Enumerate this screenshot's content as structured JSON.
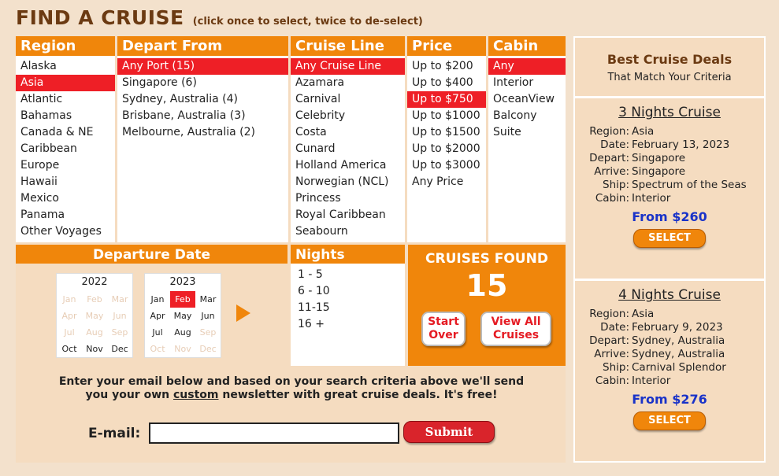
{
  "header": {
    "title": "FIND A CRUISE",
    "hint": "(click once to select, twice to de-select)"
  },
  "columns": {
    "region": {
      "label": "Region",
      "options": [
        "Alaska",
        "Asia",
        "Atlantic",
        "Bahamas",
        "Canada & NE",
        "Caribbean",
        "Europe",
        "Hawaii",
        "Mexico",
        "Panama",
        "Other Voyages"
      ],
      "selected": "Asia"
    },
    "depart": {
      "label": "Depart From",
      "options": [
        "Any Port (15)",
        "Singapore (6)",
        "Sydney, Australia (4)",
        "Brisbane, Australia (3)",
        "Melbourne, Australia (2)"
      ],
      "selected": "Any Port (15)"
    },
    "line": {
      "label": "Cruise Line",
      "options": [
        "Any Cruise Line",
        "Azamara",
        "Carnival",
        "Celebrity",
        "Costa",
        "Cunard",
        "Holland America",
        "Norwegian (NCL)",
        "Princess",
        "Royal Caribbean",
        "Seabourn"
      ],
      "selected": "Any Cruise Line"
    },
    "price": {
      "label": "Price",
      "options": [
        "Up to $200",
        "Up to $400",
        "Up to $750",
        "Up to $1000",
        "Up to $1500",
        "Up to $2000",
        "Up to $3000",
        "Any Price"
      ],
      "selected": "Up to $750"
    },
    "cabin": {
      "label": "Cabin",
      "options": [
        "Any",
        "Interior",
        "OceanView",
        "Balcony",
        "Suite"
      ],
      "selected": "Any"
    }
  },
  "departure": {
    "label": "Departure Date",
    "calendars": [
      {
        "year": "2022",
        "months": [
          {
            "m": "Jan",
            "state": "disabled"
          },
          {
            "m": "Feb",
            "state": "disabled"
          },
          {
            "m": "Mar",
            "state": "disabled"
          },
          {
            "m": "Apr",
            "state": "disabled"
          },
          {
            "m": "May",
            "state": "disabled"
          },
          {
            "m": "Jun",
            "state": "disabled"
          },
          {
            "m": "Jul",
            "state": "disabled"
          },
          {
            "m": "Aug",
            "state": "disabled"
          },
          {
            "m": "Sep",
            "state": "disabled"
          },
          {
            "m": "Oct",
            "state": "enabled"
          },
          {
            "m": "Nov",
            "state": "enabled"
          },
          {
            "m": "Dec",
            "state": "enabled"
          }
        ]
      },
      {
        "year": "2023",
        "months": [
          {
            "m": "Jan",
            "state": "enabled"
          },
          {
            "m": "Feb",
            "state": "selected"
          },
          {
            "m": "Mar",
            "state": "enabled"
          },
          {
            "m": "Apr",
            "state": "enabled"
          },
          {
            "m": "May",
            "state": "enabled"
          },
          {
            "m": "Jun",
            "state": "enabled"
          },
          {
            "m": "Jul",
            "state": "enabled"
          },
          {
            "m": "Aug",
            "state": "enabled"
          },
          {
            "m": "Sep",
            "state": "disabled"
          },
          {
            "m": "Oct",
            "state": "disabled"
          },
          {
            "m": "Nov",
            "state": "disabled"
          },
          {
            "m": "Dec",
            "state": "disabled"
          }
        ]
      }
    ]
  },
  "nights": {
    "label": "Nights",
    "options": [
      "1 - 5",
      "6 - 10",
      "11-15",
      "16 +"
    ]
  },
  "found": {
    "label": "CRUISES FOUND",
    "count": "15",
    "start_over": "Start Over",
    "view_all": "View All Cruises"
  },
  "email": {
    "message_part1": "Enter your email below and based on your search criteria above we'll send you your own ",
    "message_custom": "custom",
    "message_part2": " newsletter with great cruise deals. It's free!",
    "label": "E-mail:",
    "value": "",
    "submit": "Submit"
  },
  "deals": {
    "title": "Best Cruise Deals",
    "subtitle": "That Match Your Criteria",
    "cruises": [
      {
        "title": "3 Nights Cruise",
        "fields": [
          {
            "k": "Region:",
            "v": "Asia"
          },
          {
            "k": "Date:",
            "v": "February 13, 2023"
          },
          {
            "k": "Depart:",
            "v": "Singapore"
          },
          {
            "k": "Arrive:",
            "v": "Singapore"
          },
          {
            "k": "Ship:",
            "v": "Spectrum of the Seas"
          },
          {
            "k": "Cabin:",
            "v": "Interior"
          }
        ],
        "price": "From $260",
        "button": "SELECT"
      },
      {
        "title": "4 Nights Cruise",
        "fields": [
          {
            "k": "Region:",
            "v": "Asia"
          },
          {
            "k": "Date:",
            "v": "February 9, 2023"
          },
          {
            "k": "Depart:",
            "v": "Sydney, Australia"
          },
          {
            "k": "Arrive:",
            "v": "Sydney, Australia"
          },
          {
            "k": "Ship:",
            "v": "Carnival Splendor"
          },
          {
            "k": "Cabin:",
            "v": "Interior"
          }
        ],
        "price": "From $276",
        "button": "SELECT"
      }
    ]
  },
  "colors": {
    "accent": "#f0860b",
    "selected": "#ee1f26",
    "panel": "#f5dcc0",
    "price": "#1a33c8"
  }
}
